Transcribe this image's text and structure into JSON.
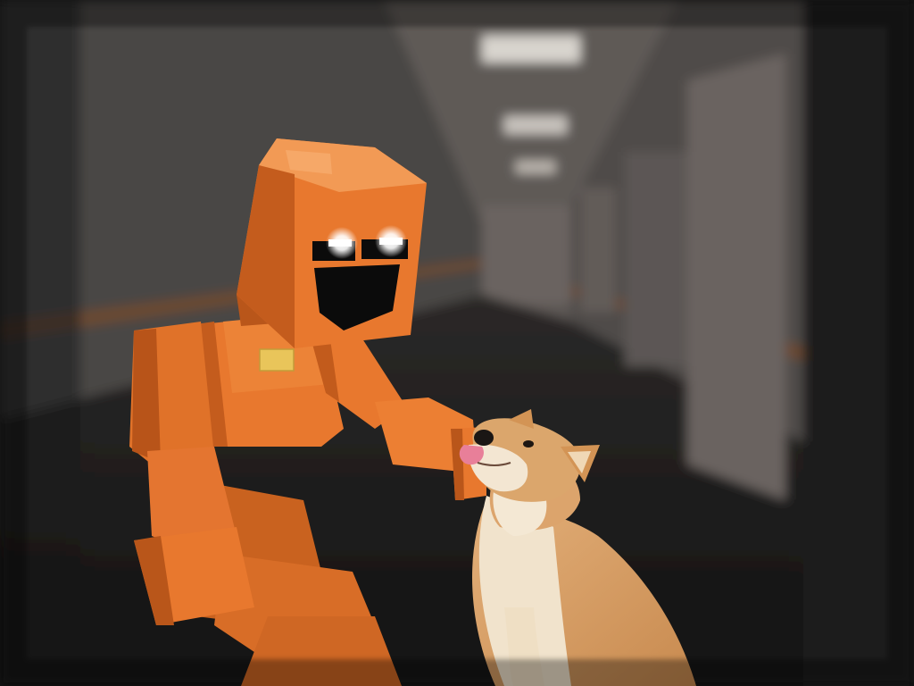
{
  "scene": {
    "subjects": [
      "orange-blocky-robot",
      "shiba-inu-dog"
    ],
    "setting": "dark-hallway",
    "colors": {
      "robot_orange": "#E8782E",
      "robot_shadow": "#B9561A",
      "robot_highlight": "#F29A55",
      "eye_glow": "#FFFFFF",
      "mouth": "#0B0B0B",
      "badge": "#E9C55A",
      "dog_fur": "#D9A268",
      "dog_cream": "#F1E3CC",
      "dog_tongue": "#E87F99",
      "hall_wall": "#5A5452",
      "hall_trim": "#6B4A33",
      "hall_ceiling_light": "#D8D4CE"
    }
  }
}
